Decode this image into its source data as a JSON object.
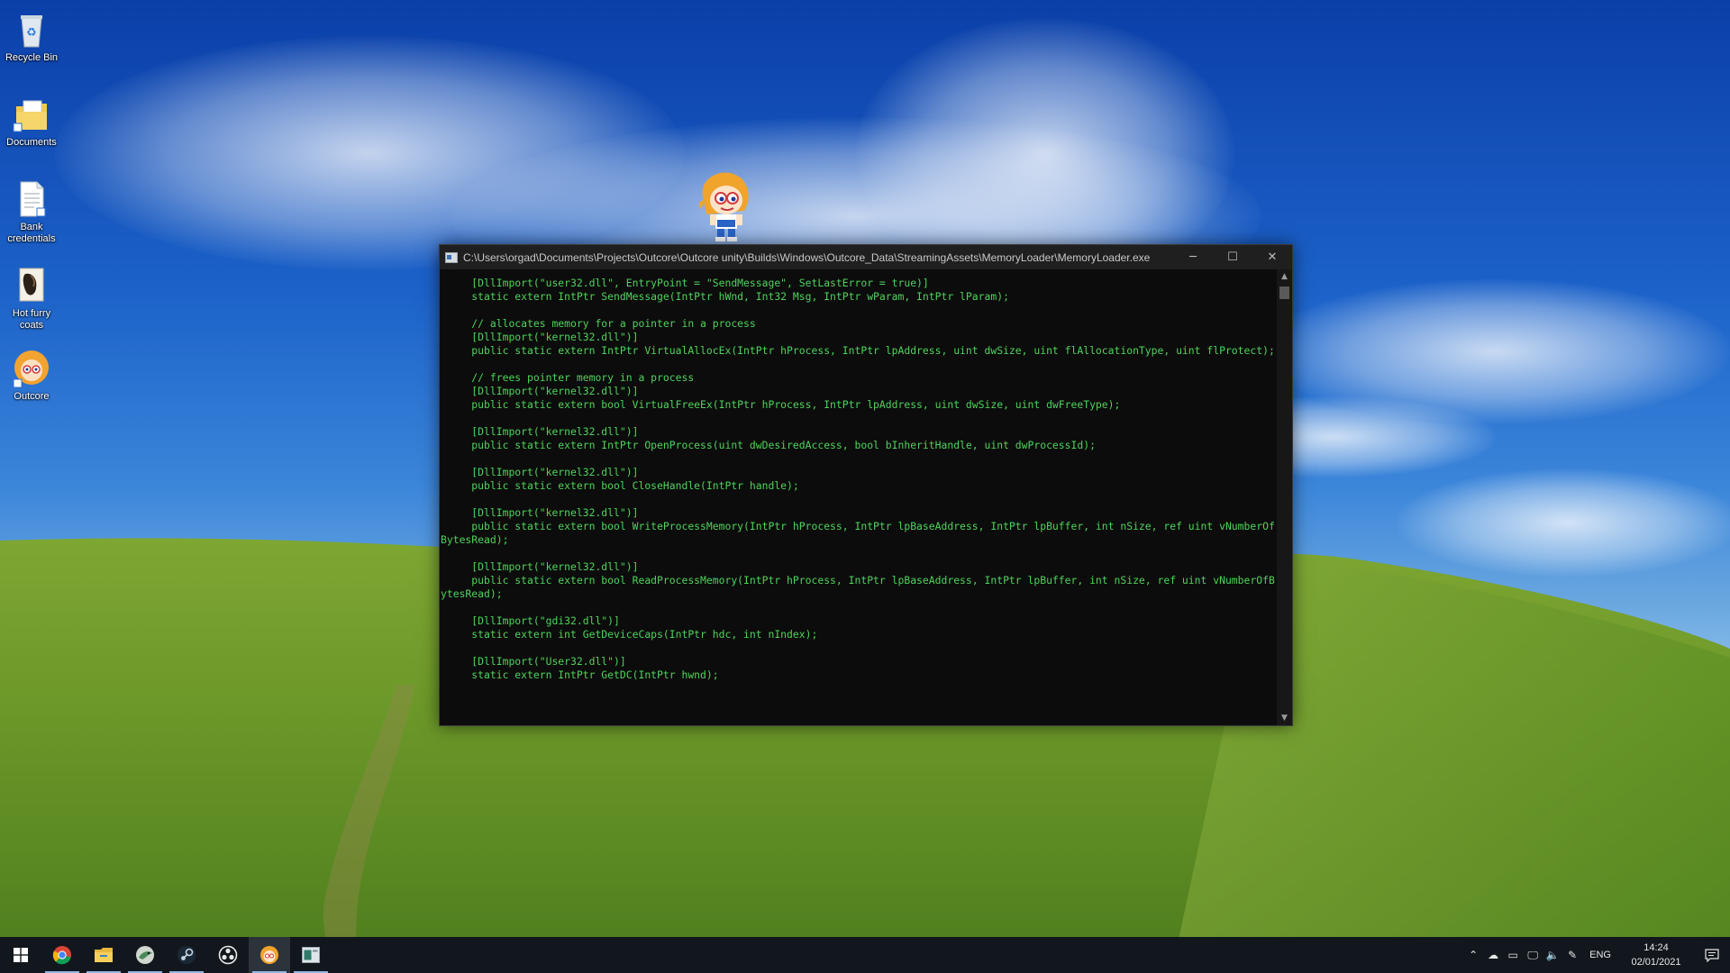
{
  "desktop": {
    "icons": [
      {
        "label": "Recycle Bin"
      },
      {
        "label": "Documents"
      },
      {
        "label": "Bank credentials"
      },
      {
        "label": "Hot furry coats"
      },
      {
        "label": "Outcore"
      }
    ]
  },
  "console": {
    "title": "C:\\Users\\orgad\\Documents\\Projects\\Outcore\\Outcore unity\\Builds\\Windows\\Outcore_Data\\StreamingAssets\\MemoryLoader\\MemoryLoader.exe",
    "minimize_symbol": "─",
    "maximize_symbol": "☐",
    "close_symbol": "✕",
    "text": "     [DllImport(\"user32.dll\", EntryPoint = \"SendMessage\", SetLastError = true)]\n     static extern IntPtr SendMessage(IntPtr hWnd, Int32 Msg, IntPtr wParam, IntPtr lParam);\n\n     // allocates memory for a pointer in a process\n     [DllImport(\"kernel32.dll\")]\n     public static extern IntPtr VirtualAllocEx(IntPtr hProcess, IntPtr lpAddress, uint dwSize, uint flAllocationType, uint flProtect);\n\n     // frees pointer memory in a process\n     [DllImport(\"kernel32.dll\")]\n     public static extern bool VirtualFreeEx(IntPtr hProcess, IntPtr lpAddress, uint dwSize, uint dwFreeType);\n\n     [DllImport(\"kernel32.dll\")]\n     public static extern IntPtr OpenProcess(uint dwDesiredAccess, bool bInheritHandle, uint dwProcessId);\n\n     [DllImport(\"kernel32.dll\")]\n     public static extern bool CloseHandle(IntPtr handle);\n\n     [DllImport(\"kernel32.dll\")]\n     public static extern bool WriteProcessMemory(IntPtr hProcess, IntPtr lpBaseAddress, IntPtr lpBuffer, int nSize, ref uint vNumberOfBytesRead);\n\n     [DllImport(\"kernel32.dll\")]\n     public static extern bool ReadProcessMemory(IntPtr hProcess, IntPtr lpBaseAddress, IntPtr lpBuffer, int nSize, ref uint vNumberOfBytesRead);\n\n     [DllImport(\"gdi32.dll\")]\n     static extern int GetDeviceCaps(IntPtr hdc, int nIndex);\n\n     [DllImport(\"User32.dll\")]\n     static extern IntPtr GetDC(IntPtr hwnd);",
    "text_color": "#4fd35b",
    "background_color": "#0c0c0c"
  },
  "taskbar": {
    "apps": [
      {
        "name": "start-button",
        "icon": "windows-logo-icon"
      },
      {
        "name": "chrome",
        "icon": "chrome-icon"
      },
      {
        "name": "file-explorer",
        "icon": "folder-icon"
      },
      {
        "name": "app-bird",
        "icon": "bird-icon"
      },
      {
        "name": "steam",
        "icon": "steam-icon"
      },
      {
        "name": "obs",
        "icon": "obs-icon"
      },
      {
        "name": "outcore",
        "icon": "outcore-icon"
      },
      {
        "name": "memory-loader",
        "icon": "console-icon"
      }
    ],
    "tray": {
      "language": "ENG",
      "time": "14:24",
      "date": "02/01/2021"
    }
  }
}
